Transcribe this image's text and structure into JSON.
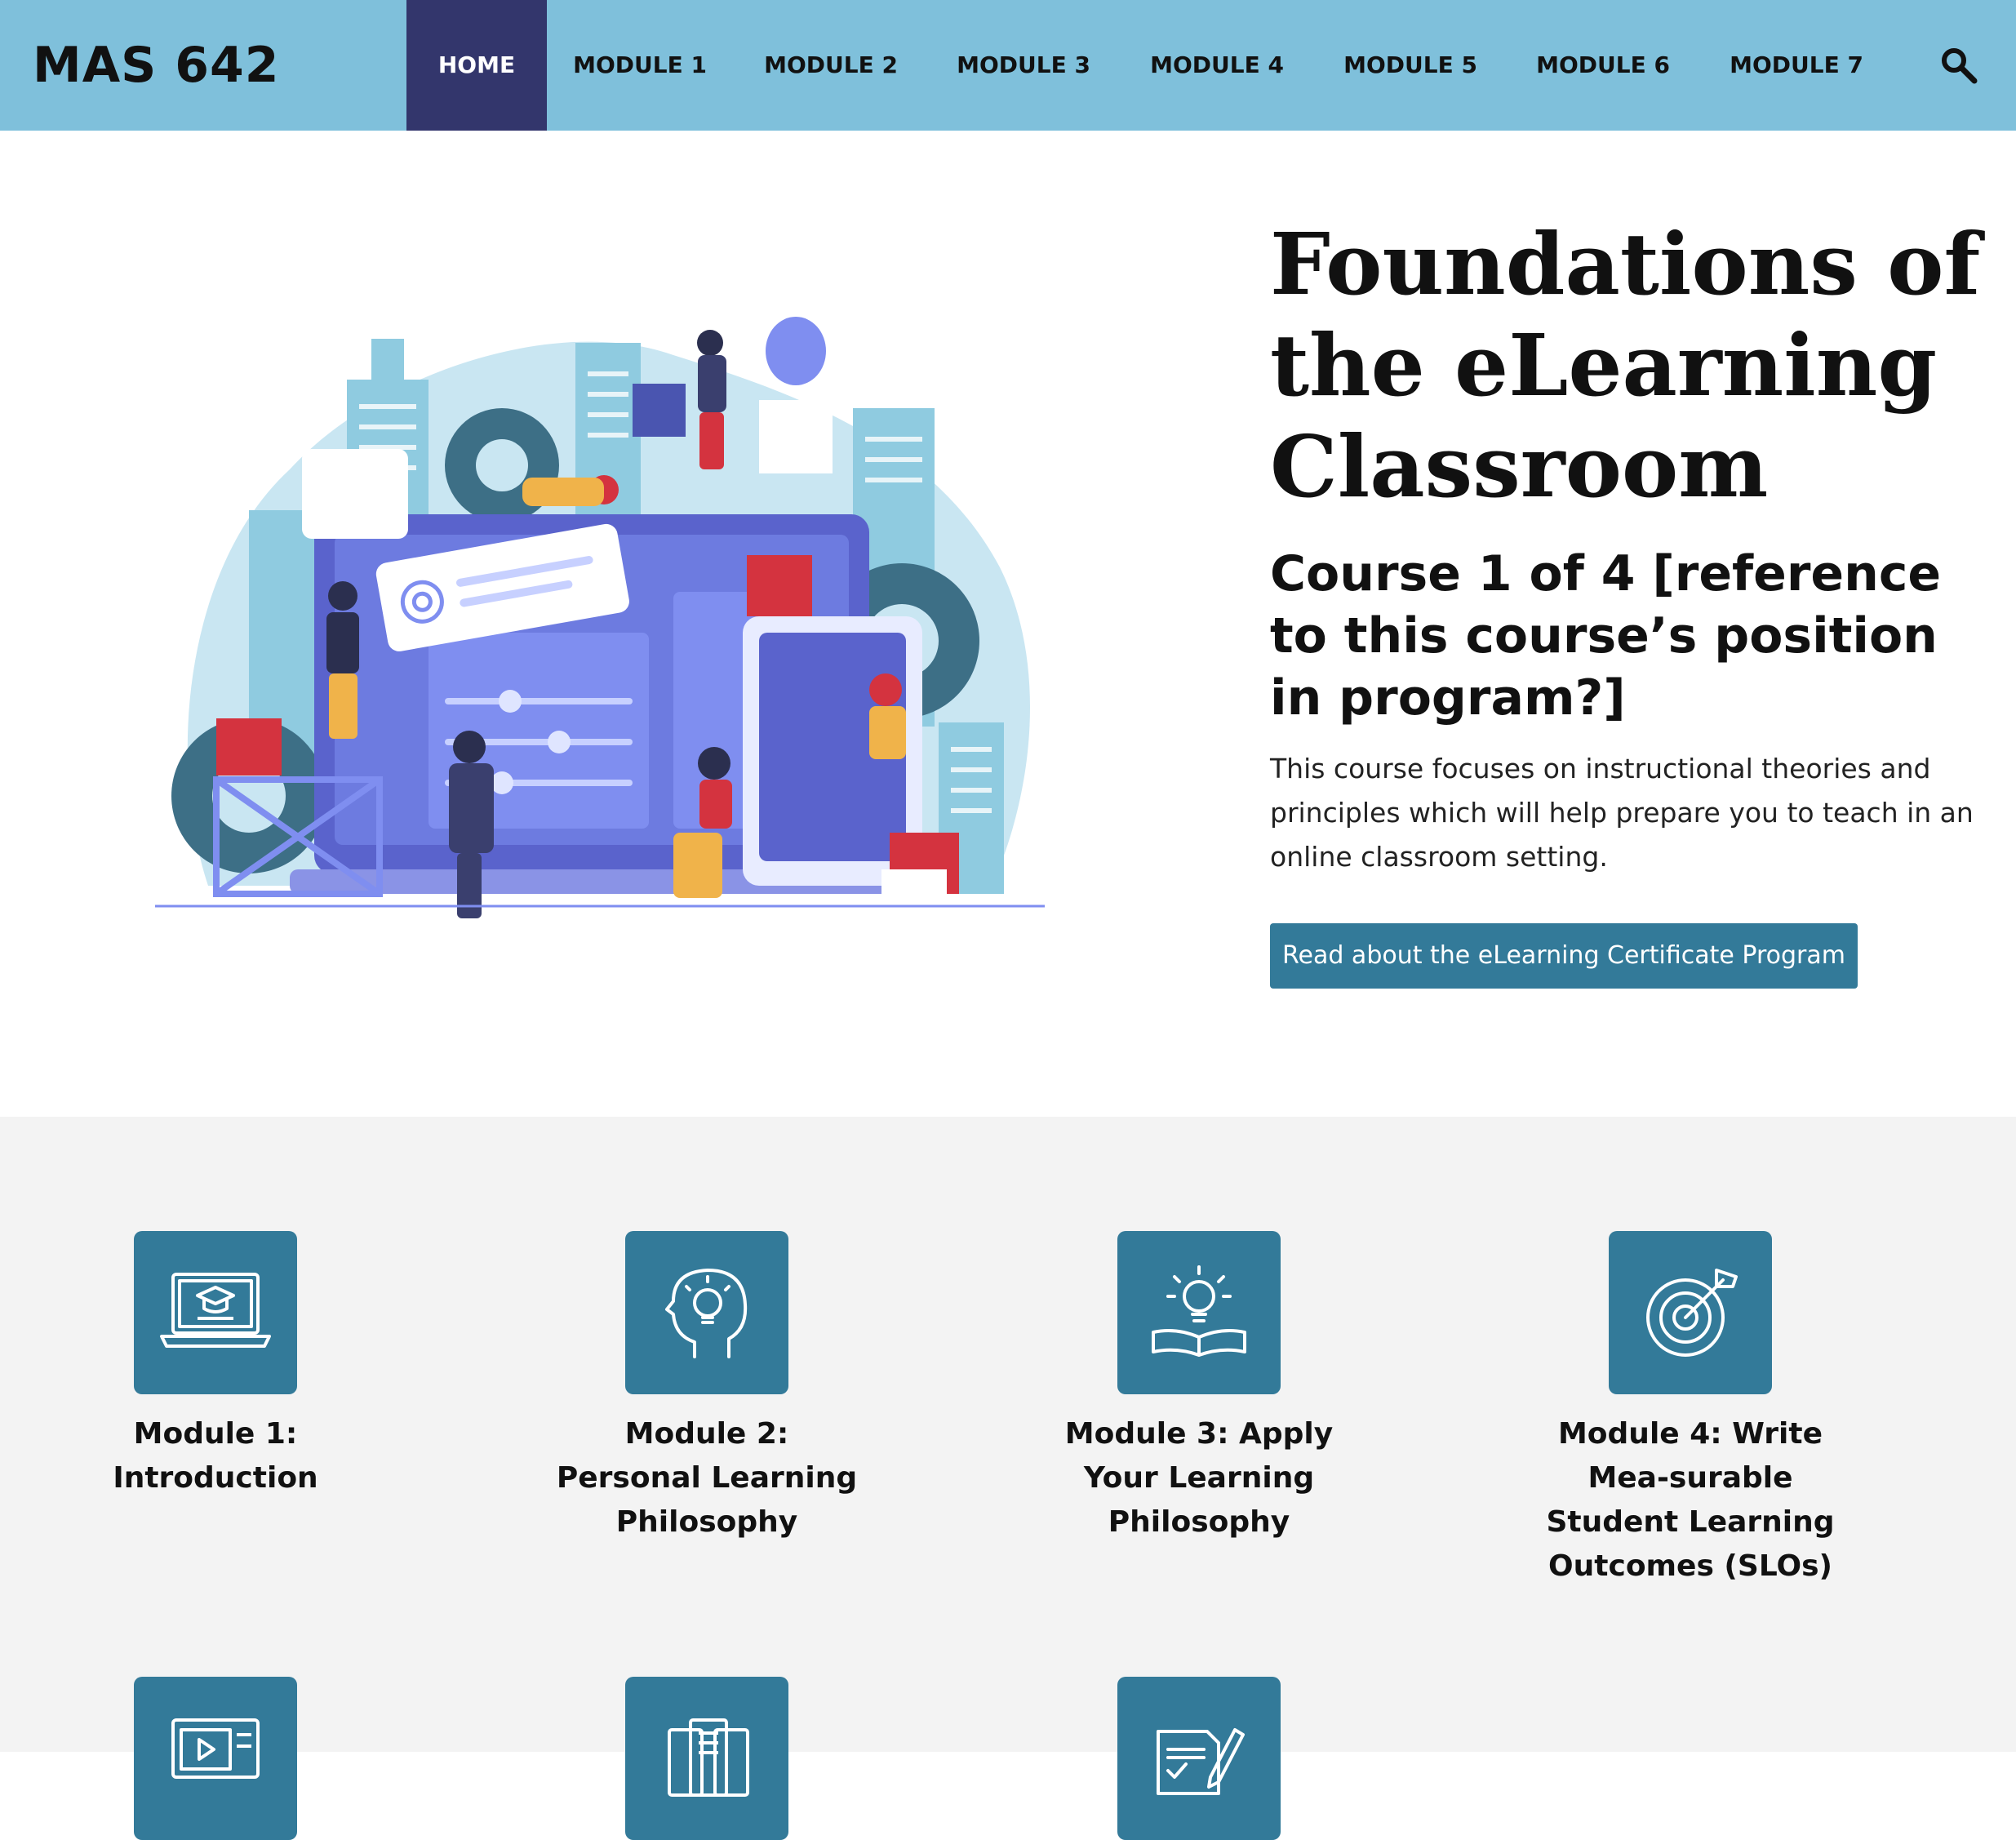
{
  "header": {
    "site_title": "MAS 642",
    "nav": [
      {
        "label": "HOME",
        "active": true
      },
      {
        "label": "MODULE 1",
        "active": false
      },
      {
        "label": "MODULE 2",
        "active": false
      },
      {
        "label": "MODULE 3",
        "active": false
      },
      {
        "label": "MODULE 4",
        "active": false
      },
      {
        "label": "MODULE 5",
        "active": false
      },
      {
        "label": "MODULE 6",
        "active": false
      },
      {
        "label": "MODULE 7",
        "active": false
      }
    ],
    "search_icon": "search-icon"
  },
  "hero": {
    "title": "Foundations of the eLearning Classroom",
    "subtitle": "Course 1 of 4 [reference to this course’s position in program?]",
    "description": "This course focuses on instructional theories and principles which will help prepare you to teach in an online classroom setting.",
    "cta_label": "Read about the eLearning Certificate Program"
  },
  "modules": [
    {
      "title": "Module 1: Introduction",
      "icon": "laptop-graduation-cap-icon"
    },
    {
      "title": "Module 2: Personal Learning Philosophy",
      "icon": "head-lightbulb-icon"
    },
    {
      "title": "Module 3: Apply Your Learning Philosophy",
      "icon": "lightbulb-book-icon"
    },
    {
      "title": "Module 4: Write Mea-surable Student Learning Outcomes (SLOs)",
      "icon": "target-arrow-icon"
    },
    {
      "title": "",
      "icon": "video-lesson-icon"
    },
    {
      "title": "",
      "icon": "documents-icon"
    },
    {
      "title": "",
      "icon": "assignment-pen-icon"
    }
  ],
  "colors": {
    "header_bg": "#7fc0db",
    "nav_active_bg": "#33366c",
    "accent": "#337a99",
    "section_bg": "#f3f3f3"
  }
}
